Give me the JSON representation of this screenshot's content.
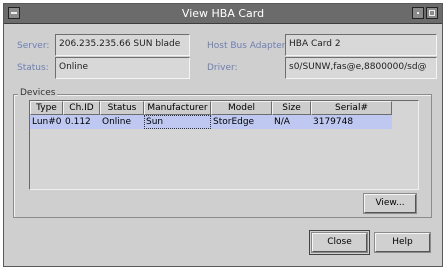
{
  "window": {
    "title": "View HBA Card"
  },
  "fields": {
    "server_label": "Server:",
    "server_value": "206.235.235.66 SUN blade",
    "host_adapter_label": "Host Bus Adapter:",
    "host_adapter_value": "HBA Card 2",
    "status_label": "Status:",
    "status_value": "Online",
    "driver_label": "Driver:",
    "driver_value": "s0/SUNW,fas@e,8800000/sd@"
  },
  "devices": {
    "group_label": "Devices",
    "columns": [
      "Type",
      "Ch.ID",
      "Status",
      "Manufacturer",
      "Model",
      "Size",
      "Serial#"
    ],
    "rows": [
      [
        "Lun#0",
        "0.112",
        "Online",
        "Sun",
        "StorEdge",
        "N/A",
        "3179748"
      ]
    ],
    "view_button": "View..."
  },
  "footer": {
    "close_button": "Close",
    "help_button": "Help"
  }
}
